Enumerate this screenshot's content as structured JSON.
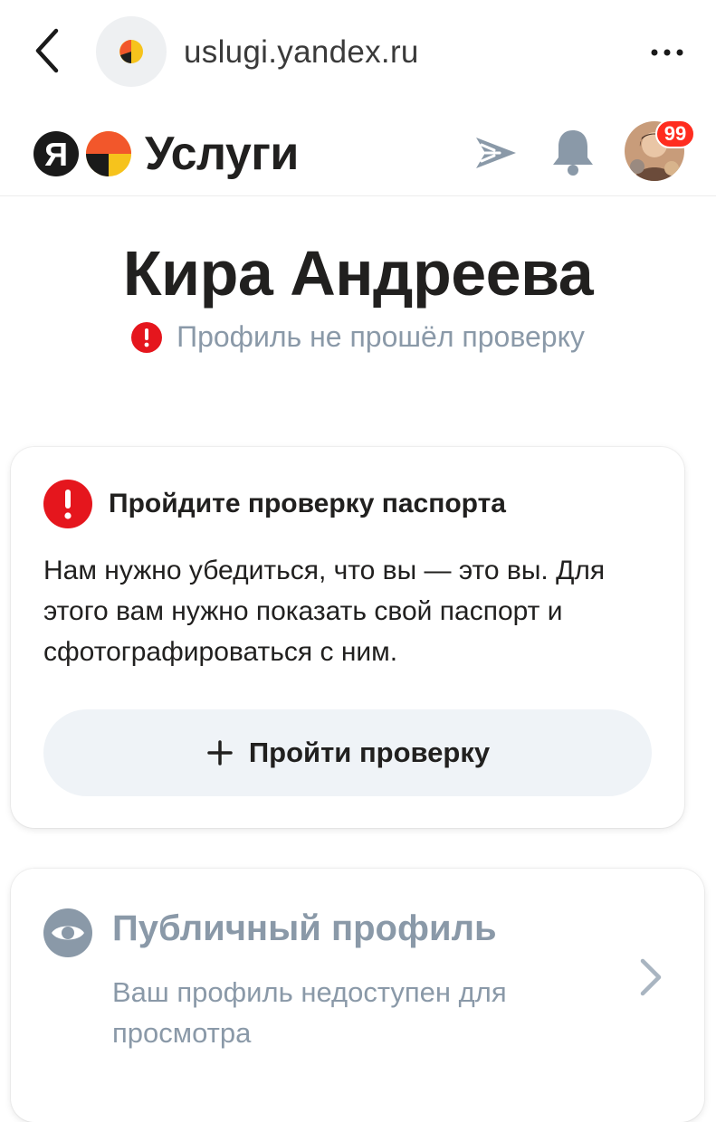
{
  "browser": {
    "url": "uslugi.yandex.ru"
  },
  "header": {
    "logo_letter": "Я",
    "service_name": "Услуги",
    "notification_count": "99"
  },
  "profile": {
    "name": "Кира Андреева",
    "status": "Профиль не прошёл проверку"
  },
  "verification_card": {
    "title": "Пройдите проверку паспорта",
    "description": "Нам нужно убедиться, что вы — это вы. Для этого вам нужно показать свой паспорт и сфотографироваться с ним.",
    "button_label": "Пройти проверку"
  },
  "public_profile_card": {
    "title": "Публичный профиль",
    "description": "Ваш профиль недоступен для просмотра"
  },
  "colors": {
    "alert_red": "#e5161d",
    "muted_text": "#8a99a8",
    "button_bg": "#eff3f7",
    "badge_red": "#ff2d1f"
  },
  "icons": [
    "back-arrow-icon",
    "site-favicon-icon",
    "more-icon",
    "send-icon",
    "bell-icon",
    "alert-icon",
    "plus-icon",
    "eye-icon",
    "chevron-right-icon"
  ]
}
